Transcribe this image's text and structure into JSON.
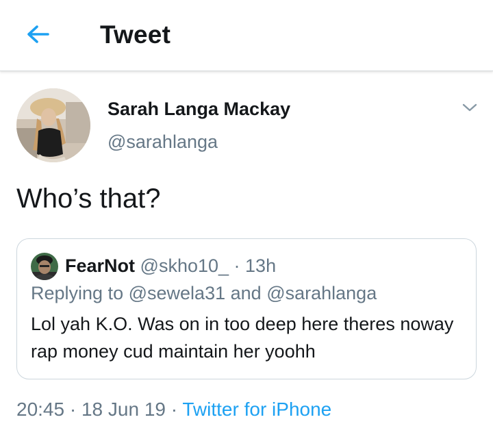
{
  "header": {
    "title": "Tweet",
    "back_icon": "arrow-left-icon",
    "accent": "#1da1f2"
  },
  "tweet": {
    "author_name": "Sarah Langa Mackay",
    "author_handle": "@sarahlanga",
    "text": "Who’s that?",
    "menu_icon": "chevron-down-icon"
  },
  "quoted_tweet": {
    "author_name": "FearNot",
    "author_handle": "@skho10_",
    "time": "· 13h",
    "reply_prefix": "Replying to",
    "reply_to_1": "@sewela31",
    "reply_and": "and",
    "reply_to_2": "@sarahlanga",
    "text": "Lol yah K.O. Was on in too deep here theres noway rap money cud maintain her yoohh"
  },
  "footer": {
    "time": "20:45",
    "sep1": "·",
    "date": "18 Jun 19",
    "sep2": "·",
    "source": "Twitter for iPhone"
  },
  "colors": {
    "text": "#14171a",
    "secondary": "#657786",
    "link": "#1da1f2",
    "border": "#ccd6dd"
  }
}
